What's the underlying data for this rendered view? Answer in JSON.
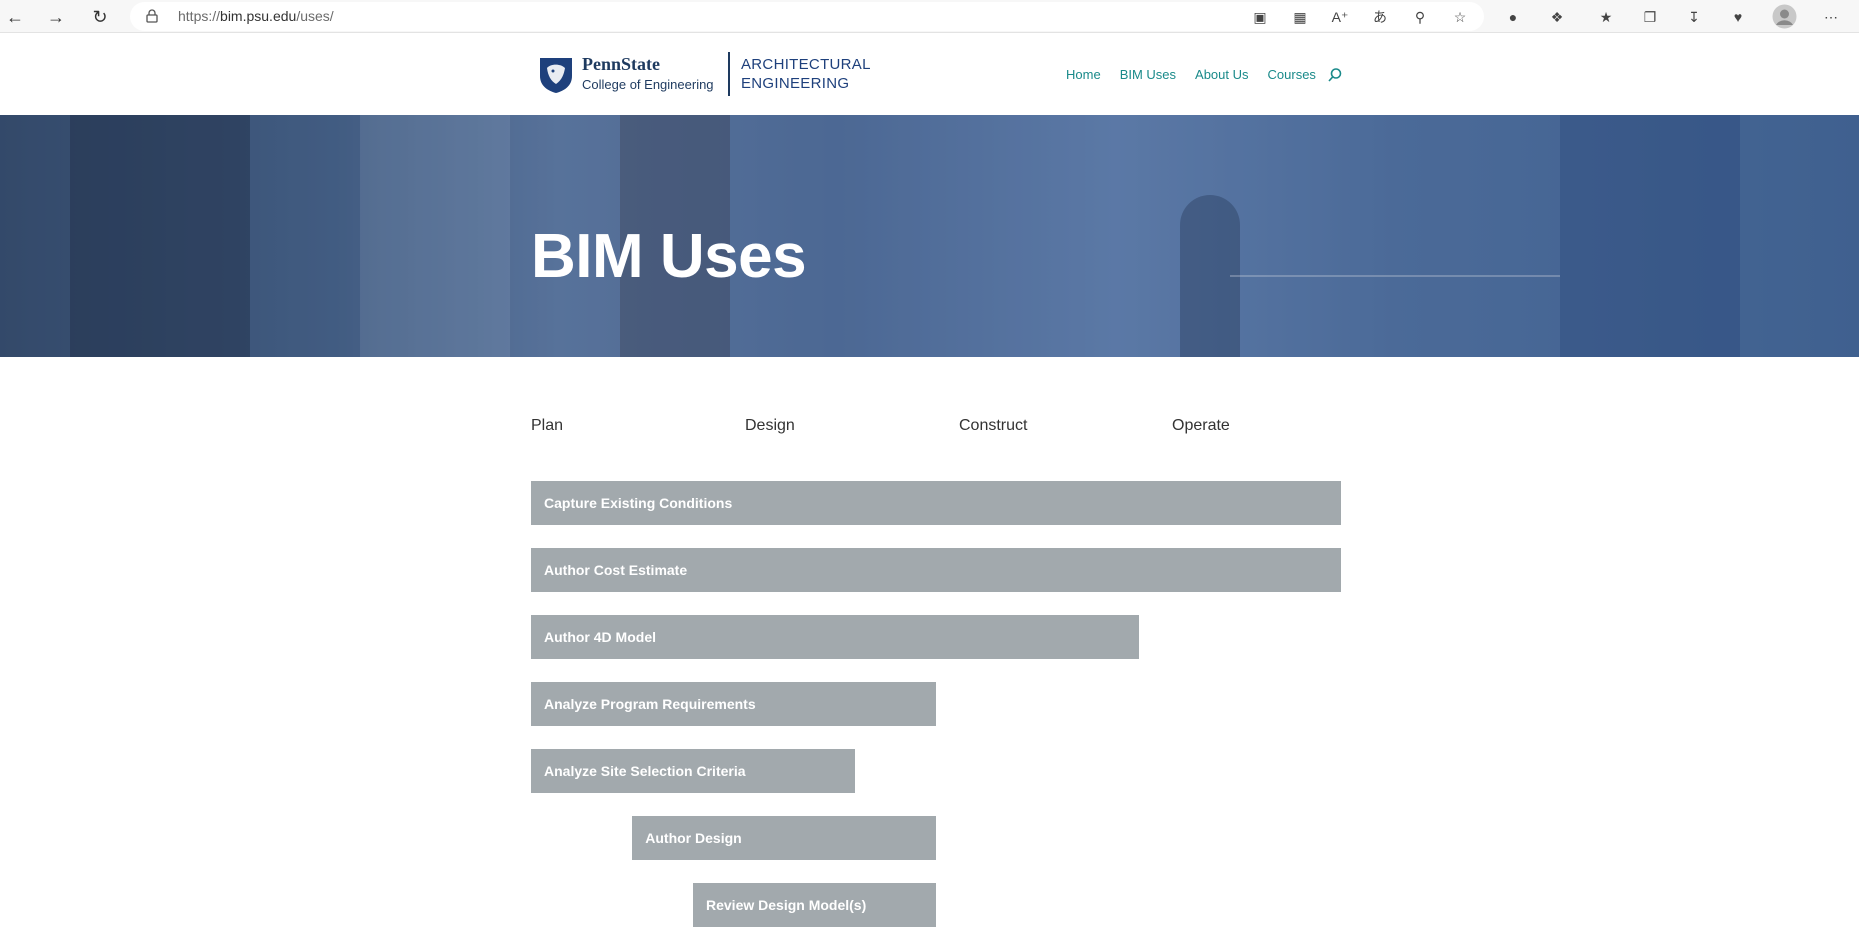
{
  "browser": {
    "url_prefix": "https://",
    "url_host": "bim.psu.edu",
    "url_path": "/uses/"
  },
  "header": {
    "logo_name": "PennState",
    "logo_sub": "College of Engineering",
    "logo_dept_line1": "ARCHITECTURAL",
    "logo_dept_line2": "ENGINEERING",
    "nav": [
      "Home",
      "BIM Uses",
      "About Us",
      "Courses"
    ]
  },
  "hero": {
    "title": "BIM Uses"
  },
  "phases": [
    "Plan",
    "Design",
    "Construct",
    "Operate"
  ],
  "uses": [
    {
      "label": "Capture Existing Conditions",
      "phase_start": 0,
      "phase_end": 4
    },
    {
      "label": "Author Cost Estimate",
      "phase_start": 0,
      "phase_end": 4
    },
    {
      "label": "Author 4D Model",
      "phase_start": 0,
      "phase_end": 3
    },
    {
      "label": "Analyze Program Requirements",
      "phase_start": 0,
      "phase_end": 2
    },
    {
      "label": "Analyze Site Selection Criteria",
      "phase_start": 0,
      "phase_end": 1.6
    },
    {
      "label": "Author Design",
      "phase_start": 0.5,
      "phase_end": 2
    },
    {
      "label": "Review Design Model(s)",
      "phase_start": 0.8,
      "phase_end": 2
    }
  ],
  "colors": {
    "bar": "#a2a9ad",
    "nav_link": "#1a8a8a",
    "brand": "#1e407c"
  }
}
